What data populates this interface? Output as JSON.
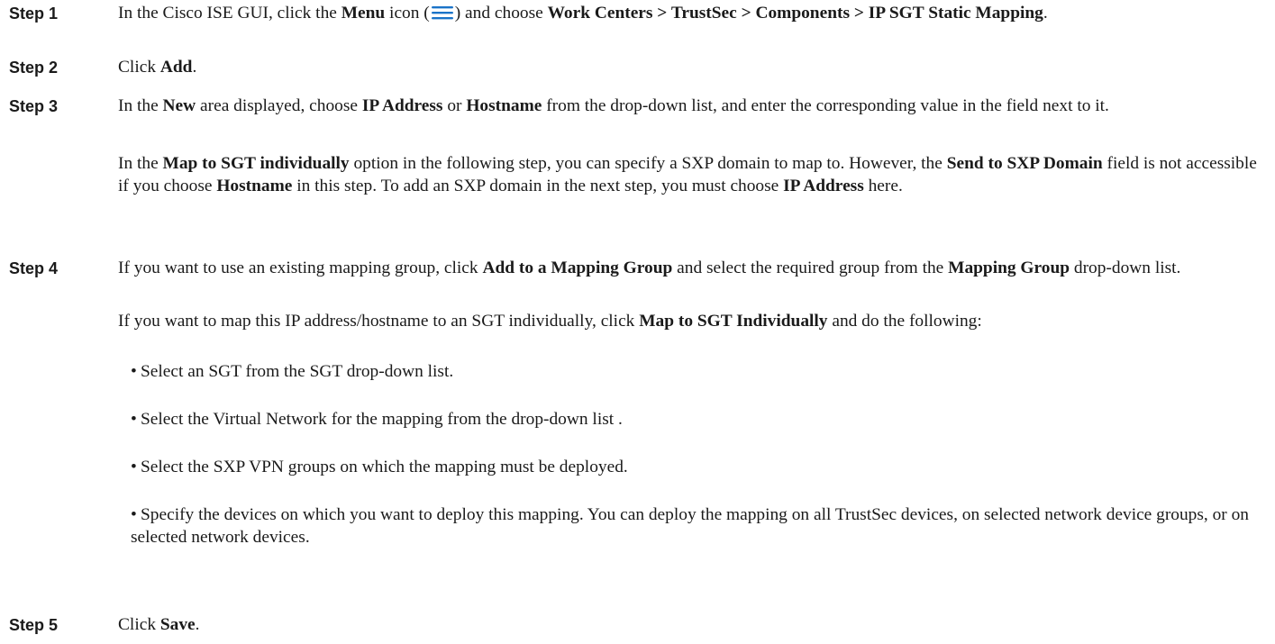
{
  "steps": [
    {
      "label": "Step 1",
      "text": {
        "t1": "In the Cisco ISE GUI, click the ",
        "menu": "Menu",
        "t2": " icon (",
        "t3": ") and choose ",
        "path": "Work Centers > TrustSec > Components > IP SGT Static Mapping",
        "t4": "."
      }
    },
    {
      "label": "Step 2",
      "text": {
        "t1": "Click ",
        "add": "Add",
        "t2": "."
      }
    },
    {
      "label": "Step 3",
      "text": {
        "t1": "In the ",
        "new": "New",
        "t2": " area displayed, choose ",
        "ip": "IP Address",
        "t3": " or ",
        "hostname": "Hostname",
        "t4": " from the drop-down list, and enter the corresponding value in the field next to it."
      },
      "note": {
        "t1": "In the ",
        "map": "Map to SGT individually",
        "t2": " option in the following step, you can specify a SXP domain to map to. However, the ",
        "send": "Send to SXP Domain",
        "t3": " field is not accessible if you choose ",
        "hostname": "Hostname",
        "t4": " in this step. To add an SXP domain in the next step, you must choose ",
        "ip": "IP Address",
        "t5": " here."
      }
    },
    {
      "label": "Step 4",
      "text": {
        "t1": "If you want to use an existing mapping group, click ",
        "add_group": "Add to a Mapping Group",
        "t2": " and select the required group from the ",
        "mapping_group": "Mapping Group",
        "t3": " drop-down list."
      },
      "text2": {
        "t1": "If you want to map this IP address/hostname to an SGT individually, click ",
        "map": "Map to SGT Individually",
        "t2": " and do the following:"
      },
      "bullets": [
        "Select an SGT from the SGT drop-down list.",
        "Select the Virtual Network for the mapping from the drop-down list .",
        "Select the SXP VPN groups on which the mapping must be deployed.",
        "Specify the devices on which you want to deploy this mapping. You can deploy the mapping on all TrustSec devices, on selected network device groups, or on selected network devices."
      ]
    },
    {
      "label": "Step 5",
      "text": {
        "t1": "Click ",
        "save": "Save",
        "t2": "."
      }
    }
  ],
  "bullet_glyph": "•",
  "colors": {
    "menu_icon": "#1a73c8"
  },
  "icons": {
    "menu": "hamburger-menu-icon"
  }
}
